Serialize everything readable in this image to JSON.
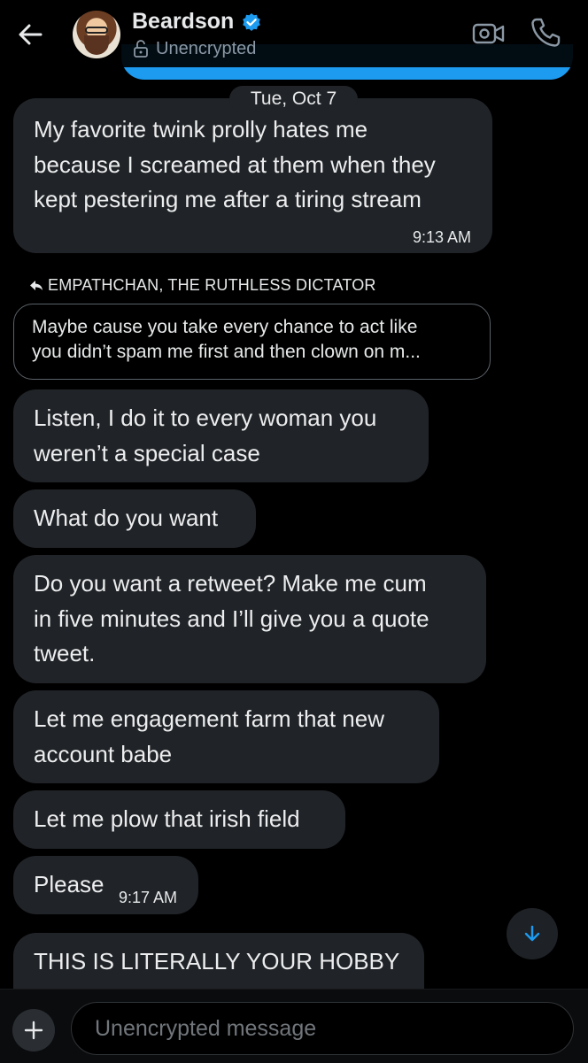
{
  "header": {
    "contact_name": "Beardson",
    "encryption_status": "Unencrypted",
    "icons": [
      "back-arrow-icon",
      "verified-badge-icon",
      "unlock-icon",
      "video-camera-icon",
      "phone-icon"
    ]
  },
  "date_divider": "Tue, Oct 7",
  "messages": [
    {
      "lines": [
        "My favorite twink prolly hates me",
        "because I screamed at them when they",
        "kept pestering me after a tiring stream"
      ],
      "time": "9:13 AM"
    },
    {
      "lines": [
        "Listen, I do it to every woman you",
        "weren’t a special case"
      ],
      "time": ""
    },
    {
      "lines": [
        "What do you want"
      ],
      "time": ""
    },
    {
      "lines": [
        "Do you want a retweet? Make me cum",
        "in five minutes and I’ll give you a quote",
        "tweet."
      ],
      "time": ""
    },
    {
      "lines": [
        "Let me engagement farm that new",
        "account babe"
      ],
      "time": ""
    },
    {
      "lines": [
        "Let me plow that irish field"
      ],
      "time": ""
    },
    {
      "lines": [
        "Please"
      ],
      "time": "9:17 AM"
    },
    {
      "lines": [
        "THIS IS LITERALLY YOUR HOBBY"
      ],
      "time": ""
    }
  ],
  "reply": {
    "to_label": "EMPATHCHAN, THE RUTHLESS DICTATOR",
    "quote_lines": [
      "Maybe cause you take every chance to act like",
      "you didn’t spam me first and then clown on m..."
    ]
  },
  "composer": {
    "placeholder": "Unencrypted message"
  },
  "colors": {
    "background": "#000000",
    "bubble": "#202327",
    "accent": "#1d9bf0",
    "muted_text": "#8b98a5"
  }
}
